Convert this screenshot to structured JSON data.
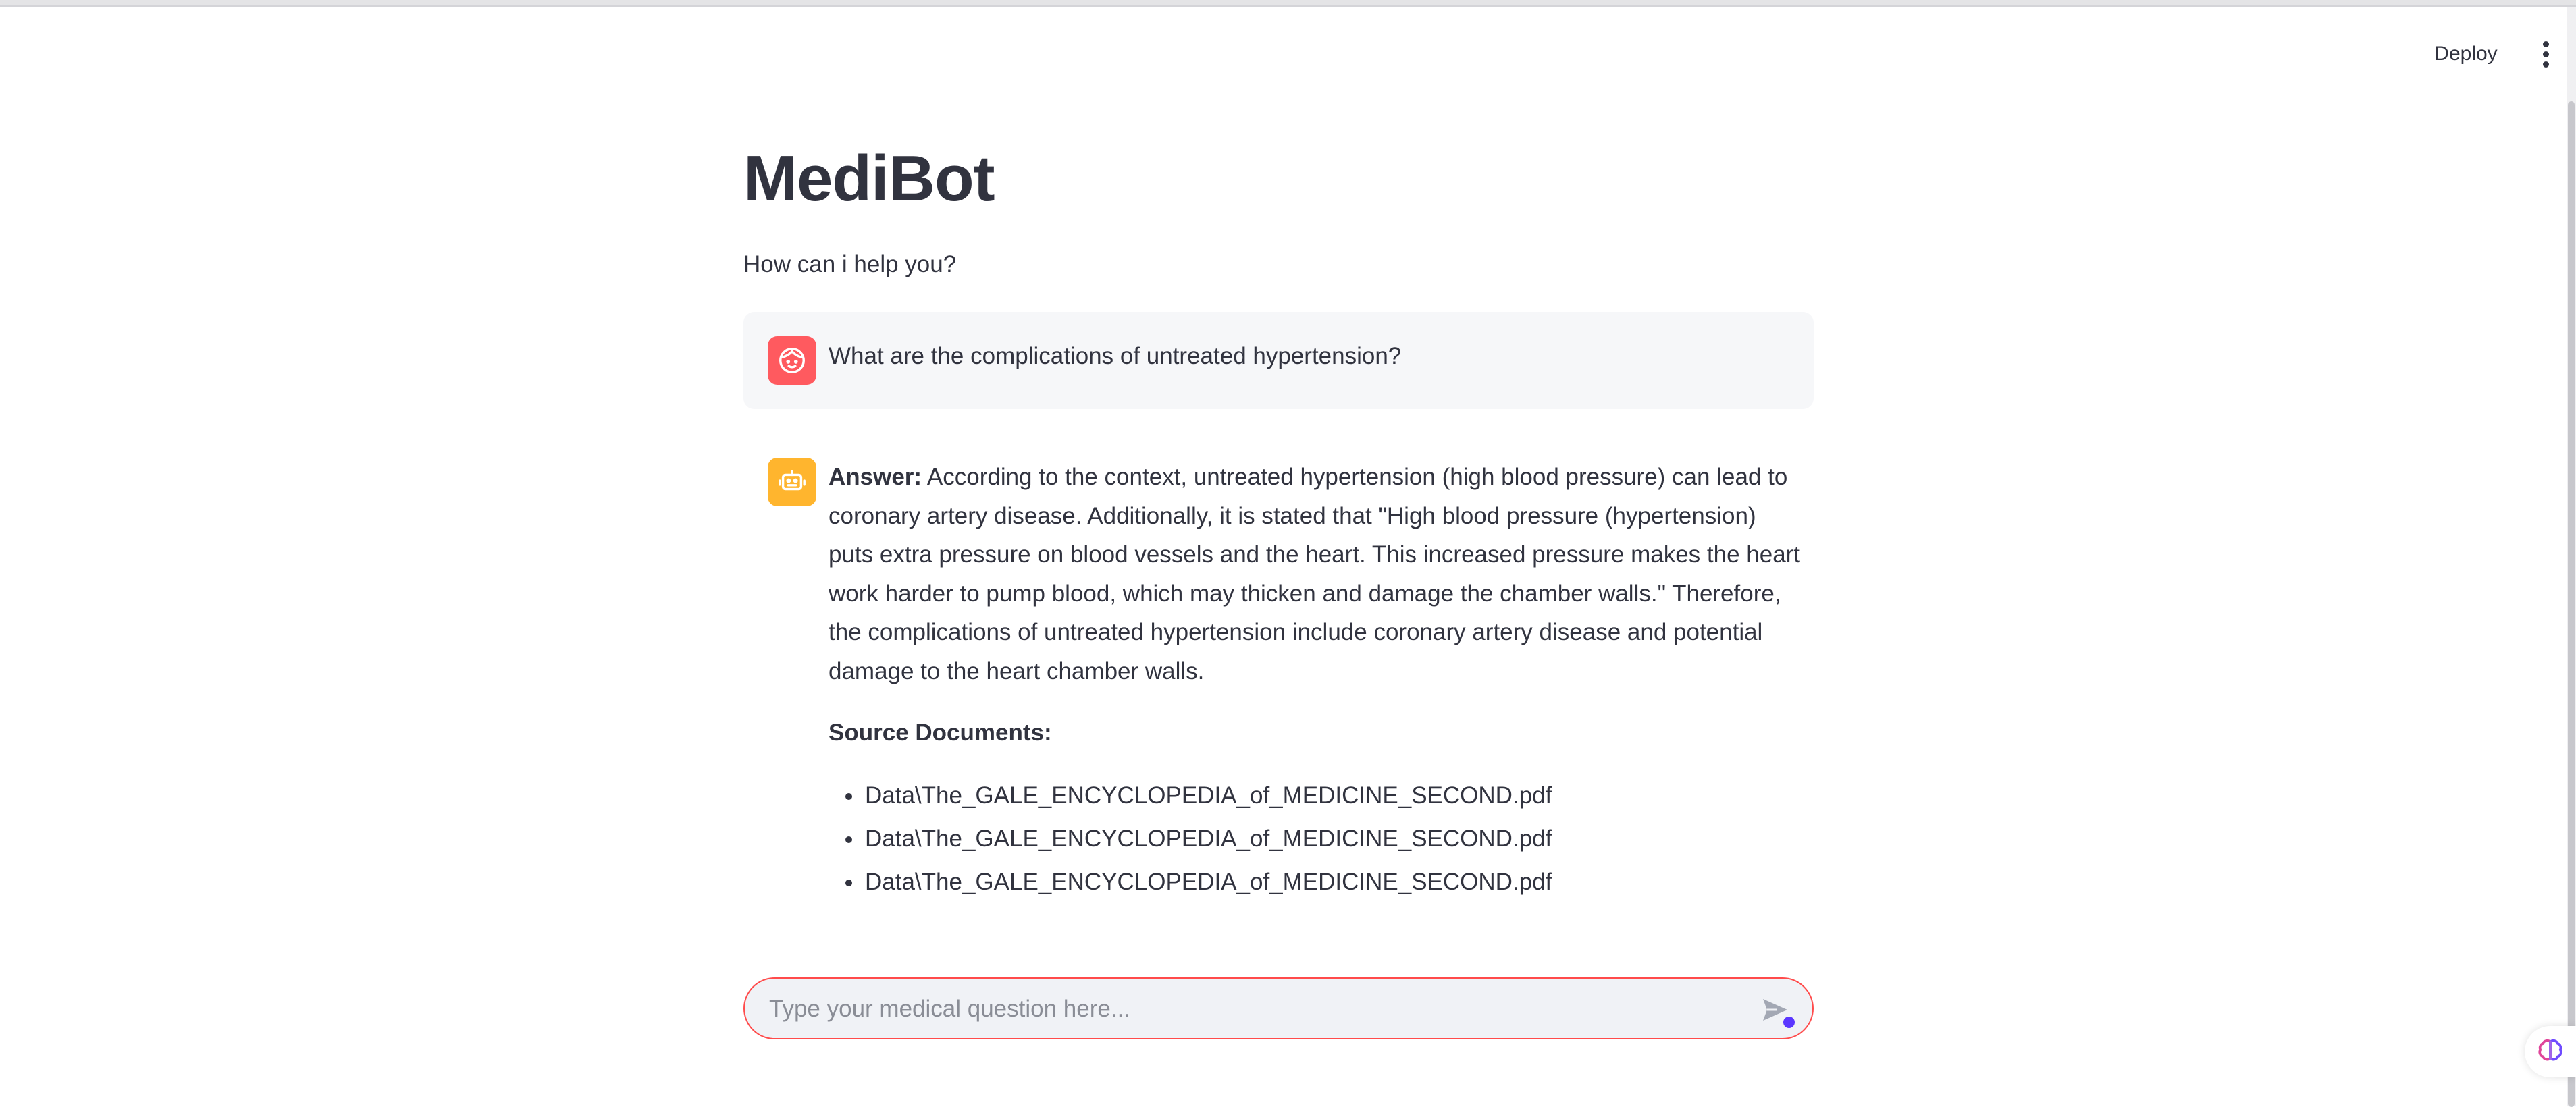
{
  "toolbar": {
    "deploy_label": "Deploy",
    "menu_icon": "kebab-menu-icon"
  },
  "page": {
    "title": "MediBot",
    "subtitle": "How can i help you?"
  },
  "chat": {
    "user_message": {
      "avatar_icon": "user-face-icon",
      "text": "What are the complications of untreated hypertension?"
    },
    "assistant_message": {
      "avatar_icon": "robot-icon",
      "answer_label": "Answer:",
      "answer_text": " According to the context, untreated hypertension (high blood pressure) can lead to coronary artery disease. Additionally, it is stated that \"High blood pressure (hypertension) puts extra pressure on blood vessels and the heart. This increased pressure makes the heart work harder to pump blood, which may thicken and damage the chamber walls.\" Therefore, the complications of untreated hypertension include coronary artery disease and potential damage to the heart chamber walls.",
      "source_heading": "Source Documents:",
      "sources": [
        "Data\\The_GALE_ENCYCLOPEDIA_of_MEDICINE_SECOND.pdf",
        "Data\\The_GALE_ENCYCLOPEDIA_of_MEDICINE_SECOND.pdf",
        "Data\\The_GALE_ENCYCLOPEDIA_of_MEDICINE_SECOND.pdf"
      ]
    }
  },
  "input": {
    "placeholder": "Type your medical question here...",
    "value": "",
    "send_icon": "send-icon"
  },
  "colors": {
    "accent": "#ff4b4b",
    "user_avatar": "#ff5a5f",
    "bot_avatar": "#ffb52e",
    "text": "#31333f",
    "user_bubble": "#f6f7f9"
  }
}
